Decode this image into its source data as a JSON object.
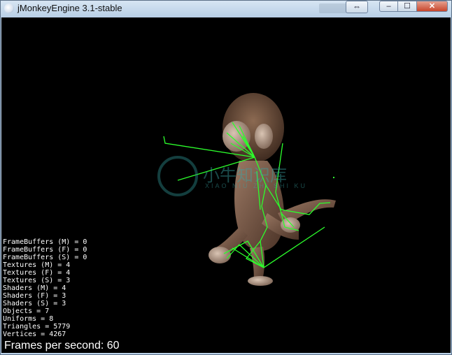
{
  "window": {
    "title": "jMonkeyEngine 3.1-stable",
    "controls": {
      "move": "⇔",
      "minimize": "–",
      "maximize": "☐",
      "close": "✕"
    }
  },
  "watermark": {
    "text": "小牛知识库",
    "subtext": "XIAO NIU ZHI SHI KU"
  },
  "stats": {
    "lines": [
      "FrameBuffers (M) = 0",
      "FrameBuffers (F) = 0",
      "FrameBuffers (S) = 0",
      "Textures (M) = 4",
      "Textures (F) = 4",
      "Textures (S) = 3",
      "Shaders (M) = 4",
      "Shaders (F) = 3",
      "Shaders (S) = 3",
      "Objects = 7",
      "Uniforms = 8",
      "Triangles = 5779",
      "Vertices = 4267"
    ],
    "fps": "Frames per second: 60"
  },
  "colors": {
    "skeleton": "#2cff2c",
    "model_skin": "#8a6a55",
    "model_fur": "#5a3c2c"
  }
}
